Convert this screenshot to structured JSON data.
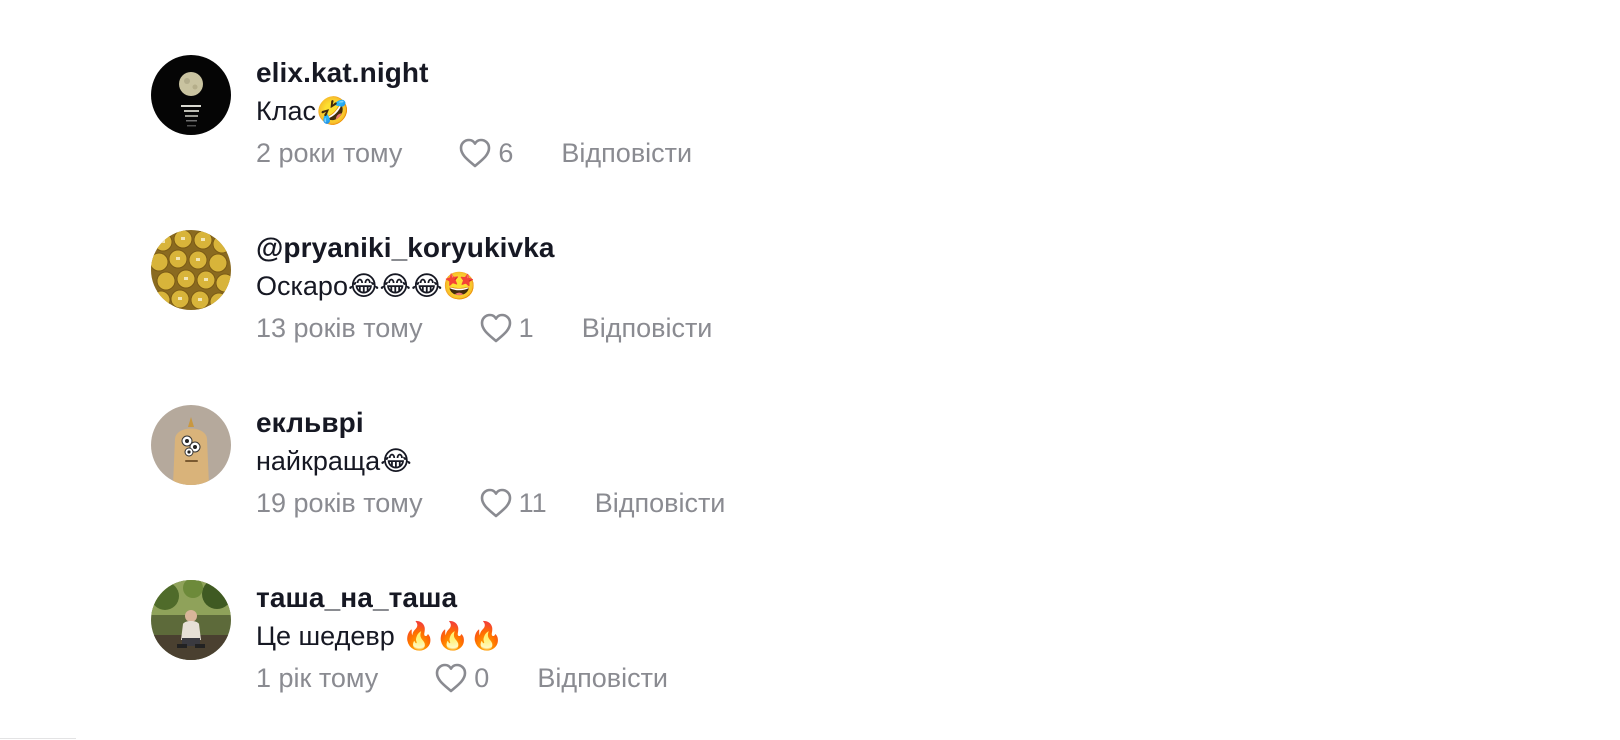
{
  "comments": [
    {
      "username": "elix.kat.night",
      "text": "Клас🤣",
      "time": "2 роки тому",
      "likes": "6",
      "reply_label": "Відповісти",
      "avatar_icon": "moon-over-water-avatar"
    },
    {
      "username": "@pryaniki_koryukivka",
      "text": "Оскаро😂😂😂🤩",
      "time": "13 років тому",
      "likes": "1",
      "reply_label": "Відповісти",
      "avatar_icon": "gingerbread-cookies-avatar"
    },
    {
      "username": "екльврі",
      "text": "найкраща😂",
      "time": "19 років тому",
      "likes": "11",
      "reply_label": "Відповісти",
      "avatar_icon": "cartoon-character-avatar"
    },
    {
      "username": "таша_на_таша",
      "text": "Це шедевр 🔥🔥🔥",
      "time": "1 рік тому",
      "likes": "0",
      "reply_label": "Відповісти",
      "avatar_icon": "person-outdoors-avatar"
    }
  ],
  "colors": {
    "text_primary": "#161823",
    "text_secondary": "#8a8b91"
  }
}
